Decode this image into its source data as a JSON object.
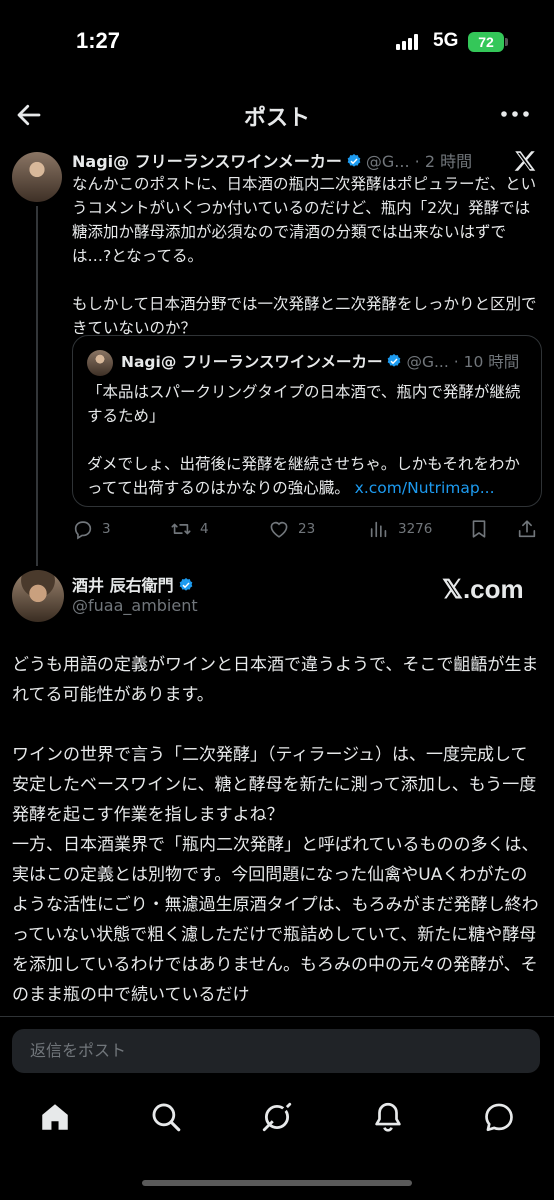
{
  "status_bar": {
    "time": "1:27",
    "network": "5G",
    "battery": "72"
  },
  "header": {
    "title": "ポスト"
  },
  "post1": {
    "author_name": "Nagi@ フリーランスワインメーカー",
    "handle": "@G...",
    "separator": "·",
    "time": "2 時間",
    "paragraphs": [
      "なんかこのポストに、日本酒の瓶内二次発酵はポピュラーだ、というコメントがいくつか付いているのだけど、瓶内「2次」発酵では糖添加か酵母添加が必須なので清酒の分類では出来ないはずでは…?となってる。",
      "もしかして日本酒分野では一次発酵と二次発酵をしっかりと区別できていないのか？"
    ],
    "quote": {
      "author_name": "Nagi@ フリーランスワインメーカー",
      "handle": "@G...",
      "separator": "·",
      "time": "10 時間",
      "paragraph1": "「本品はスパークリングタイプの日本酒で、瓶内で発酵が継続するため」",
      "paragraph2": "ダメでしょ、出荷後に発酵を継続させちゃ。しかもそれをわかってて出荷するのはかなりの強心臓。",
      "link": "x.com/Nutrimap..."
    },
    "actions": {
      "replies": "3",
      "reposts": "4",
      "likes": "23",
      "views": "3276"
    }
  },
  "reply": {
    "author_name": "酒井 辰右衛門",
    "handle": "@fuaa_ambient",
    "watermark": "𝕏.com",
    "paragraph1": "どうも用語の定義がワインと日本酒で違うようで、そこで齟齬が生まれてる可能性があります。",
    "paragraph2": "ワインの世界で言う「二次発酵」（ティラージュ）は、一度完成して安定したベースワインに、糖と酵母を新たに測って添加し、もう一度発酵を起こす作業を指しますよね？",
    "paragraph3": "一方、日本酒業界で「瓶内二次発酵」と呼ばれているものの多くは、実はこの定義とは別物です。今回問題になった仙禽やUAくわがたのような活性にごり・無濾過生原酒タイプは、もろみがまだ発酵し終わっていない状態で粗く濾しただけで瓶詰めしていて、新たに糖や酵母を添加しているわけではありません。もろみの中の元々の発酵が、そのまま瓶の中で続いているだけ"
  },
  "reply_box": {
    "placeholder": "返信をポスト"
  },
  "icons": {
    "back": "arrow-left-icon",
    "more": "more-horizontal-icon",
    "x_logo": "x-logo-icon",
    "verified": "verified-badge-icon",
    "reply": "reply-icon",
    "repost": "repost-icon",
    "like": "heart-icon",
    "views": "views-icon",
    "bookmark": "bookmark-icon",
    "share": "share-icon",
    "home": "home-icon",
    "search": "search-icon",
    "grok": "grok-icon",
    "notifications": "bell-icon",
    "messages": "messages-icon"
  },
  "colors": {
    "background": "#000000",
    "text": "#e7e9ea",
    "muted": "#71767b",
    "link": "#1d9bf0",
    "verified": "#1d9bf0",
    "battery": "#34c759"
  }
}
